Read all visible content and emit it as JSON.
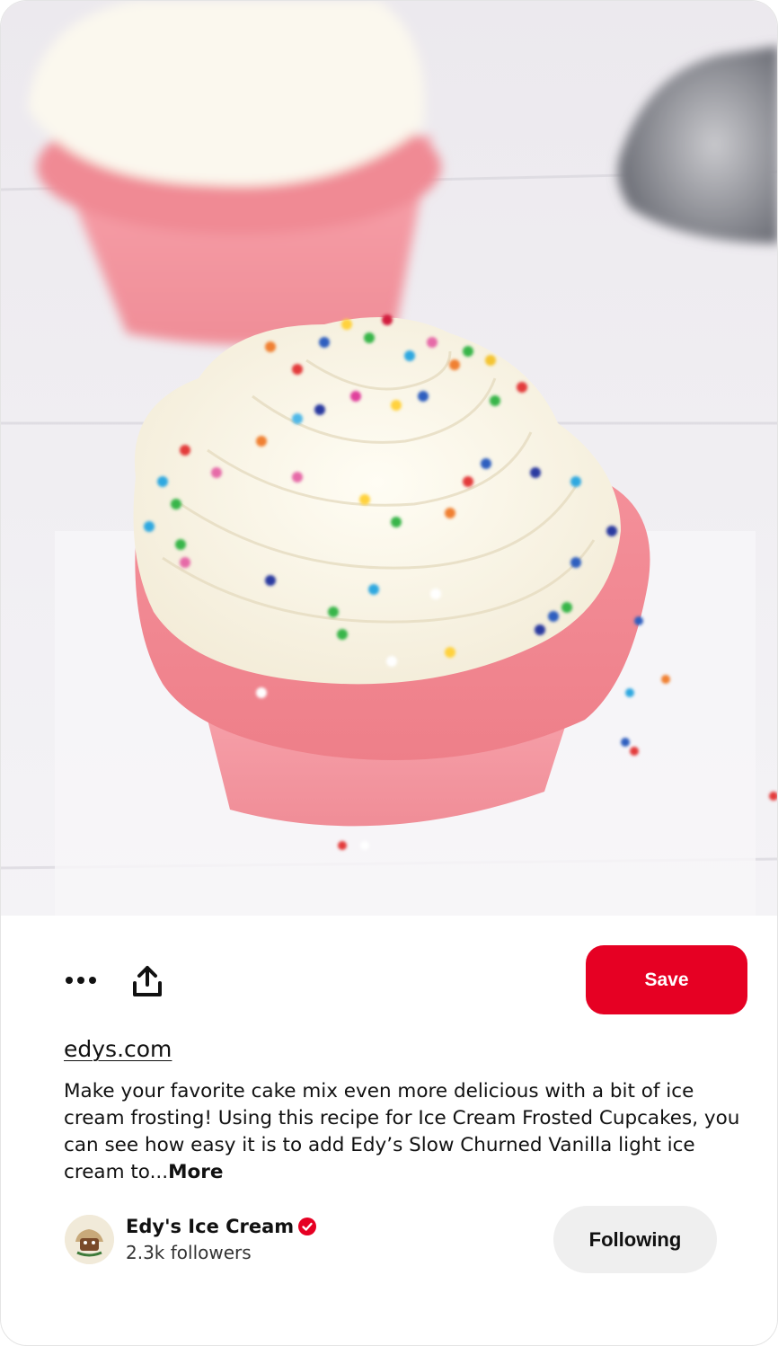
{
  "pin": {
    "image_icon": "cupcake-photo",
    "actions": {
      "more_icon": "ellipsis-icon",
      "share_icon": "share-upload-icon",
      "save_label": "Save"
    },
    "domain": "edys.com",
    "description": "Make your favorite cake mix even more delicious with a bit of ice cream frosting! Using this recipe for Ice Cream Frosted Cupcakes, you can see how easy it is to add Edy’s Slow Churned Vanilla light ice cream to...",
    "more_label": "More",
    "creator": {
      "name": "Edy's Ice Cream",
      "followers": "2.3k followers",
      "verified_icon": "verified-check-icon",
      "following_label": "Following"
    }
  },
  "colors": {
    "accent": "#e60023",
    "following_bg": "#efefef",
    "text": "#111111"
  }
}
